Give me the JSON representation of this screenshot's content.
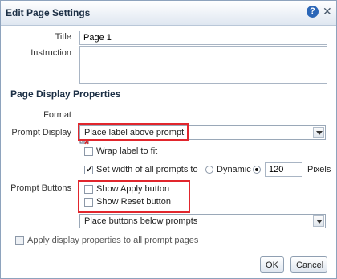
{
  "dialog": {
    "title": "Edit Page Settings",
    "help_label": "?",
    "close_label": "✕"
  },
  "fields": {
    "title_label": "Title",
    "title_value": "Page 1",
    "instruction_label": "Instruction",
    "instruction_value": ""
  },
  "page_display": {
    "section_title": "Page Display Properties",
    "format_label": "Format",
    "prompt_display_label": "Prompt Display",
    "prompt_display_selected": "Place label above prompt",
    "wrap_label_text": "Wrap label to fit",
    "wrap_label_checked": false,
    "set_width_text": "Set width of all prompts to",
    "set_width_checked": true,
    "dynamic_label": "Dynamic",
    "width_value": "120",
    "pixels_label": "Pixels"
  },
  "prompt_buttons": {
    "label": "Prompt Buttons",
    "show_apply_text": "Show Apply button",
    "show_apply_checked": false,
    "show_reset_text": "Show Reset button",
    "show_reset_checked": false,
    "placement_selected": "Place buttons below prompts"
  },
  "apply_all": {
    "text": "Apply display properties to all prompt pages",
    "checked": false
  },
  "footer": {
    "ok_label": "OK",
    "cancel_label": "Cancel"
  },
  "colors": {
    "highlight_border": "#e1262d",
    "accent": "#2b66b7"
  }
}
